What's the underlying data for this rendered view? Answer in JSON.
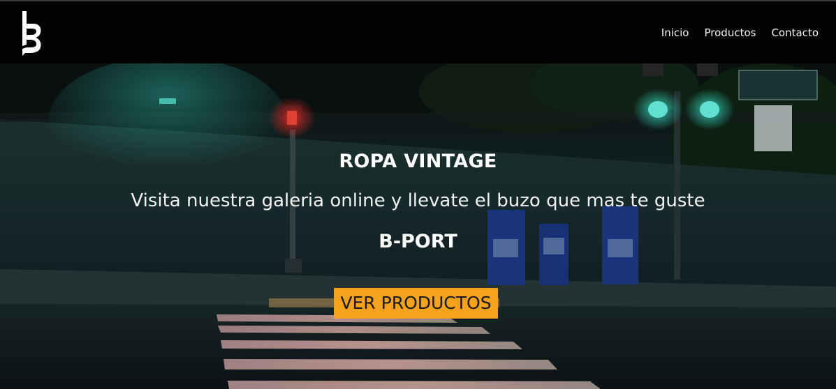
{
  "nav": {
    "logo_alt": "B",
    "links": [
      {
        "label": "Inicio"
      },
      {
        "label": "Productos"
      },
      {
        "label": "Contacto"
      }
    ]
  },
  "hero": {
    "title": "ROPA VINTAGE",
    "subtitle": "Visita nuestra galeria online y llevate el buzo que mas te guste",
    "brand": "B-PORT",
    "cta_label": "VER PRODUCTOS",
    "background_scene": "night street crosswalk with traffic lights and newspaper boxes"
  },
  "colors": {
    "navbar_bg": "#020202",
    "accent": "#f5a31c",
    "text": "#ffffff"
  }
}
